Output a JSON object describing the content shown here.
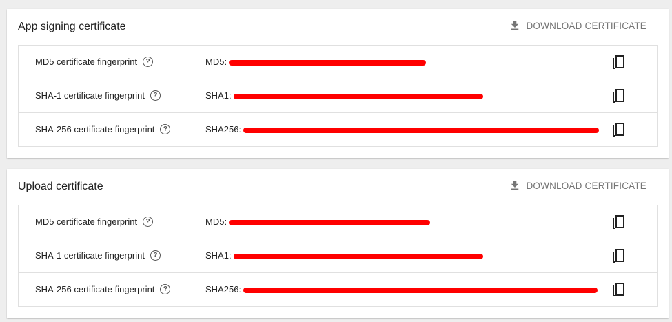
{
  "sections": [
    {
      "title": "App signing certificate",
      "download_label": "DOWNLOAD CERTIFICATE",
      "rows": [
        {
          "label": "MD5 certificate fingerprint",
          "prefix": "MD5:"
        },
        {
          "label": "SHA-1 certificate fingerprint",
          "prefix": "SHA1:"
        },
        {
          "label": "SHA-256 certificate fingerprint",
          "prefix": "SHA256:"
        }
      ]
    },
    {
      "title": "Upload certificate",
      "download_label": "DOWNLOAD CERTIFICATE",
      "rows": [
        {
          "label": "MD5 certificate fingerprint",
          "prefix": "MD5:"
        },
        {
          "label": "SHA-1 certificate fingerprint",
          "prefix": "SHA1:"
        },
        {
          "label": "SHA-256 certificate fingerprint",
          "prefix": "SHA256:"
        }
      ]
    }
  ],
  "icons": {
    "download": "download-icon",
    "help": "help-icon",
    "copy": "copy-icon"
  },
  "colors": {
    "redaction": "#ff0000",
    "muted_text": "#757575"
  }
}
